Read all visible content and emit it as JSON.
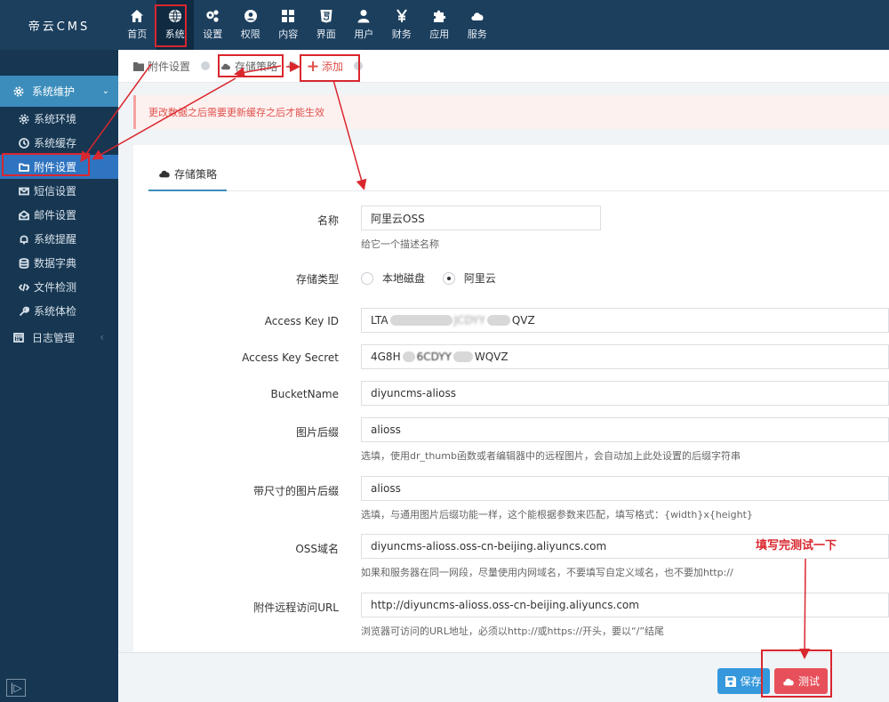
{
  "app": {
    "title": "帝云CMS"
  },
  "topnav": [
    {
      "label": "首页",
      "icon": "home-icon"
    },
    {
      "label": "系统",
      "icon": "globe-icon",
      "active": true
    },
    {
      "label": "设置",
      "icon": "cogs-icon"
    },
    {
      "label": "权限",
      "icon": "user-circle-icon"
    },
    {
      "label": "内容",
      "icon": "grid-icon"
    },
    {
      "label": "界面",
      "icon": "html5-icon"
    },
    {
      "label": "用户",
      "icon": "user-icon"
    },
    {
      "label": "财务",
      "icon": "yen-icon"
    },
    {
      "label": "应用",
      "icon": "puzzle-icon"
    },
    {
      "label": "服务",
      "icon": "cloud-icon"
    }
  ],
  "sidebar": {
    "group": "系统维护",
    "items": [
      {
        "label": "系统环境",
        "icon": "gear-icon"
      },
      {
        "label": "系统缓存",
        "icon": "clock-icon"
      },
      {
        "label": "附件设置",
        "icon": "folder-icon",
        "active": true
      },
      {
        "label": "短信设置",
        "icon": "envelope-icon"
      },
      {
        "label": "邮件设置",
        "icon": "envelope-open-icon"
      },
      {
        "label": "系统提醒",
        "icon": "bell-icon"
      },
      {
        "label": "数据字典",
        "icon": "database-icon"
      },
      {
        "label": "文件检测",
        "icon": "code-icon"
      },
      {
        "label": "系统体检",
        "icon": "wrench-icon"
      }
    ],
    "group2": "日志管理"
  },
  "breadcrumb": {
    "items": [
      "附件设置",
      "存储策略",
      "添加"
    ]
  },
  "alert": {
    "text": "更改数据之后需要更新缓存之后才能生效"
  },
  "tab": {
    "label": "存储策略"
  },
  "form": {
    "name_label": "名称",
    "name_value": "阿里云OSS",
    "name_help": "给它一个描述名称",
    "type_label": "存储类型",
    "type_options": [
      "本地磁盘",
      "阿里云"
    ],
    "type_selected": "阿里云",
    "akid_label": "Access Key ID",
    "akid_value_start": "LTA",
    "akid_value_mid": "JCDYY",
    "akid_value_end": "QVZ",
    "aks_label": "Access Key Secret",
    "aks_value_start": "4G8H",
    "aks_value_mid": "6CDYY",
    "aks_value_end": "WQVZ",
    "bucket_label": "BucketName",
    "bucket_value": "diyuncms-alioss",
    "suffix_label": "图片后缀",
    "suffix_value": "alioss",
    "suffix_help": "选填，使用dr_thumb函数或者编辑器中的远程图片，会自动加上此处设置的后缀字符串",
    "size_suffix_label": "带尺寸的图片后缀",
    "size_suffix_value": "alioss",
    "size_suffix_help": "选填，与通用图片后缀功能一样，这个能根据参数来匹配，填写格式：{width}x{height}",
    "domain_label": "OSS域名",
    "domain_value": "diyuncms-alioss.oss-cn-beijing.aliyuncs.com",
    "domain_help": "如果和服务器在同一网段，尽量使用内网域名，不要填写自定义域名，也不要加http://",
    "url_label": "附件远程访问URL",
    "url_value": "http://diyuncms-alioss.oss-cn-beijing.aliyuncs.com",
    "url_help": "浏览器可访问的URL地址，必须以http://或https://开头，要以“/”结尾"
  },
  "buttons": {
    "save": "保存",
    "test": "测试"
  },
  "annotation": {
    "note": "填写完测试一下"
  },
  "colors": {
    "topbar": "#1c3f5e",
    "sidebar": "#163651",
    "accent": "#3c8dbc",
    "danger": "#e7505a",
    "annotation": "#d9272e"
  }
}
